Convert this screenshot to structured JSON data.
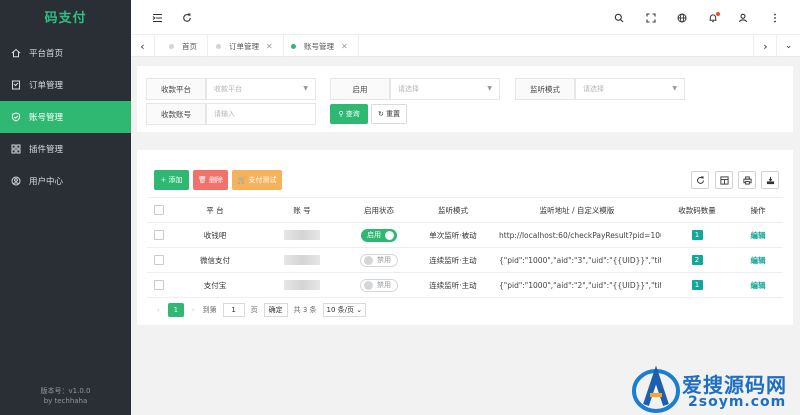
{
  "sidebar": {
    "logo": "码支付",
    "items": [
      {
        "label": "平台首页",
        "icon": "home-icon"
      },
      {
        "label": "订单管理",
        "icon": "order-icon"
      },
      {
        "label": "账号管理",
        "icon": "shield-check-icon"
      },
      {
        "label": "插件管理",
        "icon": "grid-icon"
      },
      {
        "label": "用户中心",
        "icon": "user-circle-icon"
      }
    ],
    "version": "版本号：v1.0.0",
    "author": "by techhaha"
  },
  "header": {
    "icons": [
      "menu-fold-icon",
      "refresh-icon",
      "search-icon",
      "fullscreen-icon",
      "globe-icon",
      "bell-icon",
      "user-icon",
      "more-icon"
    ]
  },
  "tabs": [
    {
      "label": "首页",
      "active": false
    },
    {
      "label": "订单管理",
      "active": false
    },
    {
      "label": "账号管理",
      "active": true
    }
  ],
  "search": {
    "platform_label": "收款平台",
    "platform_placeholder": "收款平台",
    "enable_label": "启用",
    "enable_placeholder": "请选择",
    "mode_label": "监听模式",
    "mode_placeholder": "请选择",
    "account_label": "收款账号",
    "account_placeholder": "请输入",
    "query_button": "查询",
    "reset_button": "重置"
  },
  "toolbar": {
    "add_button": "添加",
    "delete_button": "删除",
    "pay_test_button": "支付测试"
  },
  "table": {
    "columns": [
      "平 台",
      "账 号",
      "启用状态",
      "监听模式",
      "监听地址 / 自定义模版",
      "收款码数量",
      "操作"
    ],
    "rows": [
      {
        "platform": "收钱吧",
        "account": "",
        "status": "启用",
        "enabled": true,
        "mode": "单次监听·被动",
        "url": "http://localhost:60/checkPayResult?pid=1000&aid",
        "count": "1",
        "action": "编辑"
      },
      {
        "platform": "微信支付",
        "account": "",
        "status": "禁用",
        "enabled": false,
        "mode": "连续监听·主动",
        "url": "{\"pid\":\"1000\",\"aid\":\"3\",\"uid\":\"{{UID}}\",\"title\":\"{{TITLI",
        "count": "2",
        "action": "编辑"
      },
      {
        "platform": "支付宝",
        "account": "",
        "status": "禁用",
        "enabled": false,
        "mode": "连续监听·主动",
        "url": "{\"pid\":\"1000\",\"aid\":\"2\",\"uid\":\"{{UID}}\",\"title\":\"{{TITLI",
        "count": "1",
        "action": "编辑"
      }
    ]
  },
  "pager": {
    "current": "1",
    "goto_label": "到第",
    "goto_value": "1",
    "page_label": "页",
    "confirm": "确定",
    "total": "共 3 条",
    "page_size": "10 条/页"
  },
  "watermark": {
    "text": "爱搜源码网",
    "sub": "2soym.com"
  },
  "colors": {
    "primary": "#2eb872",
    "sidebar": "#2a2f35",
    "danger": "#f2726b",
    "warning": "#f6b25a",
    "badge": "#13a79a"
  }
}
